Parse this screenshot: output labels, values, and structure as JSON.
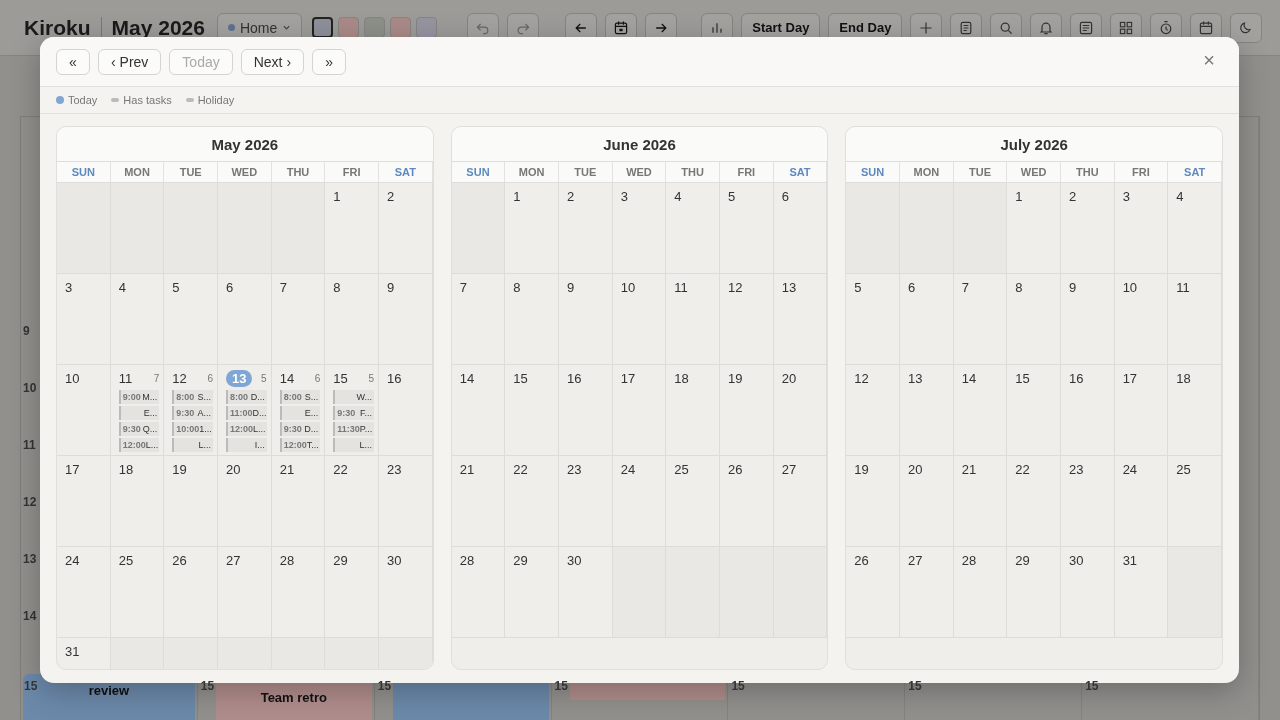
{
  "header": {
    "app_name": "Kiroku",
    "period": "May 2026",
    "workspace": "Home",
    "swatches": [
      {
        "color": "#8d9098",
        "selected": true
      },
      {
        "color": "#a98a89",
        "selected": false
      },
      {
        "color": "#8d9089",
        "selected": false
      },
      {
        "color": "#a98a89",
        "selected": false
      },
      {
        "color": "#9694a1",
        "selected": false
      }
    ],
    "buttons": [
      "Start Day",
      "End Day"
    ]
  },
  "week": {
    "gutter_hours": [
      "9",
      "10",
      "11",
      "12",
      "13",
      "14"
    ],
    "columns": [
      {
        "hour": "15",
        "event": {
          "title": "review",
          "color": "#6c89aa"
        }
      },
      {
        "hour": "15",
        "event": {
          "title": "Team retro",
          "color": "#b08d8c"
        }
      },
      {
        "hour": "15",
        "event": {
          "color": "#6c89aa"
        }
      },
      {
        "hour": "15",
        "event": {
          "color": "#b08d8c"
        }
      },
      {
        "hour": "15"
      },
      {
        "hour": "15"
      },
      {
        "hour": "15"
      }
    ]
  },
  "modal": {
    "nav": [
      {
        "label": "«",
        "disabled": false
      },
      {
        "label": "‹ Prev",
        "disabled": false
      },
      {
        "label": "Today",
        "disabled": true
      },
      {
        "label": "Next ›",
        "disabled": false
      },
      {
        "label": "»",
        "disabled": false
      }
    ],
    "close": "×",
    "legend": [
      {
        "label": "Today",
        "kind": "dot"
      },
      {
        "label": "Has tasks",
        "kind": "bar"
      },
      {
        "label": "Holiday",
        "kind": "bar"
      }
    ],
    "months": [
      {
        "title": "May 2026",
        "weekdays": [
          {
            "label": "SUN",
            "weekend": true
          },
          {
            "label": "MON",
            "weekend": false
          },
          {
            "label": "TUE",
            "weekend": false
          },
          {
            "label": "WED",
            "weekend": false
          },
          {
            "label": "THU",
            "weekend": false
          },
          {
            "label": "FRI",
            "weekend": false
          },
          {
            "label": "SAT",
            "weekend": true
          }
        ],
        "weeks": [
          [
            {
              "kind": "blank"
            },
            {
              "kind": "blank"
            },
            {
              "kind": "blank"
            },
            {
              "kind": "blank"
            },
            {
              "kind": "blank"
            },
            {
              "kind": "day",
              "day": "1",
              "today": false
            },
            {
              "kind": "day",
              "day": "2",
              "today": false
            }
          ],
          [
            {
              "kind": "day",
              "day": "3",
              "today": false
            },
            {
              "kind": "day",
              "day": "4",
              "today": false
            },
            {
              "kind": "day",
              "day": "5",
              "today": false
            },
            {
              "kind": "day",
              "day": "6",
              "today": false
            },
            {
              "kind": "day",
              "day": "7",
              "today": false
            },
            {
              "kind": "day",
              "day": "8",
              "today": false
            },
            {
              "kind": "day",
              "day": "9",
              "today": false
            }
          ],
          [
            {
              "kind": "day",
              "day": "10",
              "today": false
            },
            {
              "kind": "day",
              "day": "11",
              "today": false,
              "count": "7",
              "events": [
                {
                  "time": "9:00",
                  "title": "M..."
                },
                {
                  "title": "E..."
                },
                {
                  "time": "9:30",
                  "title": "Q..."
                },
                {
                  "time": "12:00",
                  "title": "L..."
                }
              ]
            },
            {
              "kind": "day",
              "day": "12",
              "today": false,
              "count": "6",
              "events": [
                {
                  "time": "8:00",
                  "title": "S..."
                },
                {
                  "time": "9:30",
                  "title": "A..."
                },
                {
                  "time": "10:00",
                  "title": "1..."
                },
                {
                  "title": "L..."
                }
              ]
            },
            {
              "kind": "day",
              "day": "13",
              "today": true,
              "count": "5",
              "events": [
                {
                  "time": "8:00",
                  "title": "D..."
                },
                {
                  "time": "11:00",
                  "title": "D..."
                },
                {
                  "time": "12:00",
                  "title": "L..."
                },
                {
                  "title": "I..."
                }
              ]
            },
            {
              "kind": "day",
              "day": "14",
              "today": false,
              "count": "6",
              "events": [
                {
                  "time": "8:00",
                  "title": "S..."
                },
                {
                  "title": "E..."
                },
                {
                  "time": "9:30",
                  "title": "D..."
                },
                {
                  "time": "12:00",
                  "title": "T..."
                }
              ]
            },
            {
              "kind": "day",
              "day": "15",
              "today": false,
              "count": "5",
              "events": [
                {
                  "title": "W..."
                },
                {
                  "time": "9:30",
                  "title": "F..."
                },
                {
                  "time": "11:30",
                  "title": "P..."
                },
                {
                  "title": "L..."
                }
              ]
            },
            {
              "kind": "day",
              "day": "16",
              "today": false
            }
          ],
          [
            {
              "kind": "day",
              "day": "17",
              "today": false
            },
            {
              "kind": "day",
              "day": "18",
              "today": false
            },
            {
              "kind": "day",
              "day": "19",
              "today": false
            },
            {
              "kind": "day",
              "day": "20",
              "today": false
            },
            {
              "kind": "day",
              "day": "21",
              "today": false
            },
            {
              "kind": "day",
              "day": "22",
              "today": false
            },
            {
              "kind": "day",
              "day": "23",
              "today": false
            }
          ],
          [
            {
              "kind": "day",
              "day": "24",
              "today": false
            },
            {
              "kind": "day",
              "day": "25",
              "today": false
            },
            {
              "kind": "day",
              "day": "26",
              "today": false
            },
            {
              "kind": "day",
              "day": "27",
              "today": false
            },
            {
              "kind": "day",
              "day": "28",
              "today": false
            },
            {
              "kind": "day",
              "day": "29",
              "today": false
            },
            {
              "kind": "day",
              "day": "30",
              "today": false
            }
          ],
          [
            {
              "kind": "day",
              "day": "31",
              "today": false
            },
            {
              "kind": "blank"
            },
            {
              "kind": "blank"
            },
            {
              "kind": "blank"
            },
            {
              "kind": "blank"
            },
            {
              "kind": "blank"
            },
            {
              "kind": "blank"
            }
          ]
        ]
      },
      {
        "title": "June 2026",
        "weekdays": [
          {
            "label": "SUN",
            "weekend": true
          },
          {
            "label": "MON",
            "weekend": false
          },
          {
            "label": "TUE",
            "weekend": false
          },
          {
            "label": "WED",
            "weekend": false
          },
          {
            "label": "THU",
            "weekend": false
          },
          {
            "label": "FRI",
            "weekend": false
          },
          {
            "label": "SAT",
            "weekend": true
          }
        ],
        "weeks": [
          [
            {
              "kind": "blank"
            },
            {
              "kind": "day",
              "day": "1",
              "today": false
            },
            {
              "kind": "day",
              "day": "2",
              "today": false
            },
            {
              "kind": "day",
              "day": "3",
              "today": false
            },
            {
              "kind": "day",
              "day": "4",
              "today": false
            },
            {
              "kind": "day",
              "day": "5",
              "today": false
            },
            {
              "kind": "day",
              "day": "6",
              "today": false
            }
          ],
          [
            {
              "kind": "day",
              "day": "7",
              "today": false
            },
            {
              "kind": "day",
              "day": "8",
              "today": false
            },
            {
              "kind": "day",
              "day": "9",
              "today": false
            },
            {
              "kind": "day",
              "day": "10",
              "today": false
            },
            {
              "kind": "day",
              "day": "11",
              "today": false
            },
            {
              "kind": "day",
              "day": "12",
              "today": false
            },
            {
              "kind": "day",
              "day": "13",
              "today": false
            }
          ],
          [
            {
              "kind": "day",
              "day": "14",
              "today": false
            },
            {
              "kind": "day",
              "day": "15",
              "today": false
            },
            {
              "kind": "day",
              "day": "16",
              "today": false
            },
            {
              "kind": "day",
              "day": "17",
              "today": false
            },
            {
              "kind": "day",
              "day": "18",
              "today": false
            },
            {
              "kind": "day",
              "day": "19",
              "today": false
            },
            {
              "kind": "day",
              "day": "20",
              "today": false
            }
          ],
          [
            {
              "kind": "day",
              "day": "21",
              "today": false
            },
            {
              "kind": "day",
              "day": "22",
              "today": false
            },
            {
              "kind": "day",
              "day": "23",
              "today": false
            },
            {
              "kind": "day",
              "day": "24",
              "today": false
            },
            {
              "kind": "day",
              "day": "25",
              "today": false
            },
            {
              "kind": "day",
              "day": "26",
              "today": false
            },
            {
              "kind": "day",
              "day": "27",
              "today": false
            }
          ],
          [
            {
              "kind": "day",
              "day": "28",
              "today": false
            },
            {
              "kind": "day",
              "day": "29",
              "today": false
            },
            {
              "kind": "day",
              "day": "30",
              "today": false
            },
            {
              "kind": "blank"
            },
            {
              "kind": "blank"
            },
            {
              "kind": "blank"
            },
            {
              "kind": "blank"
            }
          ]
        ]
      },
      {
        "title": "July 2026",
        "weekdays": [
          {
            "label": "SUN",
            "weekend": true
          },
          {
            "label": "MON",
            "weekend": false
          },
          {
            "label": "TUE",
            "weekend": false
          },
          {
            "label": "WED",
            "weekend": false
          },
          {
            "label": "THU",
            "weekend": false
          },
          {
            "label": "FRI",
            "weekend": false
          },
          {
            "label": "SAT",
            "weekend": true
          }
        ],
        "weeks": [
          [
            {
              "kind": "blank"
            },
            {
              "kind": "blank"
            },
            {
              "kind": "blank"
            },
            {
              "kind": "day",
              "day": "1",
              "today": false
            },
            {
              "kind": "day",
              "day": "2",
              "today": false
            },
            {
              "kind": "day",
              "day": "3",
              "today": false
            },
            {
              "kind": "day",
              "day": "4",
              "today": false
            }
          ],
          [
            {
              "kind": "day",
              "day": "5",
              "today": false
            },
            {
              "kind": "day",
              "day": "6",
              "today": false
            },
            {
              "kind": "day",
              "day": "7",
              "today": false
            },
            {
              "kind": "day",
              "day": "8",
              "today": false
            },
            {
              "kind": "day",
              "day": "9",
              "today": false
            },
            {
              "kind": "day",
              "day": "10",
              "today": false
            },
            {
              "kind": "day",
              "day": "11",
              "today": false
            }
          ],
          [
            {
              "kind": "day",
              "day": "12",
              "today": false
            },
            {
              "kind": "day",
              "day": "13",
              "today": false
            },
            {
              "kind": "day",
              "day": "14",
              "today": false
            },
            {
              "kind": "day",
              "day": "15",
              "today": false
            },
            {
              "kind": "day",
              "day": "16",
              "today": false
            },
            {
              "kind": "day",
              "day": "17",
              "today": false
            },
            {
              "kind": "day",
              "day": "18",
              "today": false
            }
          ],
          [
            {
              "kind": "day",
              "day": "19",
              "today": false
            },
            {
              "kind": "day",
              "day": "20",
              "today": false
            },
            {
              "kind": "day",
              "day": "21",
              "today": false
            },
            {
              "kind": "day",
              "day": "22",
              "today": false
            },
            {
              "kind": "day",
              "day": "23",
              "today": false
            },
            {
              "kind": "day",
              "day": "24",
              "today": false
            },
            {
              "kind": "day",
              "day": "25",
              "today": false
            }
          ],
          [
            {
              "kind": "day",
              "day": "26",
              "today": false
            },
            {
              "kind": "day",
              "day": "27",
              "today": false
            },
            {
              "kind": "day",
              "day": "28",
              "today": false
            },
            {
              "kind": "day",
              "day": "29",
              "today": false
            },
            {
              "kind": "day",
              "day": "30",
              "today": false
            },
            {
              "kind": "day",
              "day": "31",
              "today": false
            },
            {
              "kind": "blank"
            }
          ]
        ]
      }
    ]
  }
}
